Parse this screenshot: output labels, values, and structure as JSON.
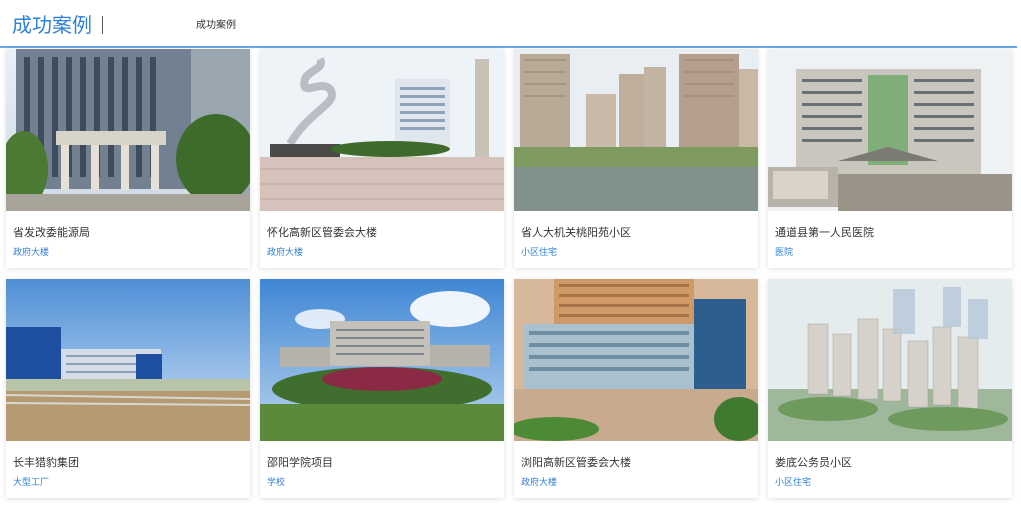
{
  "header": {
    "title": "成功案例",
    "breadcrumb": "成功案例"
  },
  "colors": {
    "accent": "#2f80d8",
    "header_rule": "#6aa6e6",
    "card_title": "#333333"
  },
  "cases": [
    {
      "name": "省发改委能源局",
      "category": "政府大楼",
      "photo": "government-building-photo"
    },
    {
      "name": "怀化高新区管委会大楼",
      "category": "政府大楼",
      "photo": "plaza-sculpture-photo"
    },
    {
      "name": "省人大机关桃阳苑小区",
      "category": "小区住宅",
      "photo": "residential-towers-lake-photo"
    },
    {
      "name": "通道县第一人民医院",
      "category": "医院",
      "photo": "hospital-building-photo"
    },
    {
      "name": "长丰猎豹集团",
      "category": "大型工厂",
      "photo": "factory-photo"
    },
    {
      "name": "邵阳学院项目",
      "category": "学校",
      "photo": "college-campus-photo"
    },
    {
      "name": "浏阳高新区管委会大楼",
      "category": "政府大楼",
      "photo": "office-complex-photo"
    },
    {
      "name": "娄底公务员小区",
      "category": "小区住宅",
      "photo": "residential-aerial-render-photo"
    }
  ]
}
